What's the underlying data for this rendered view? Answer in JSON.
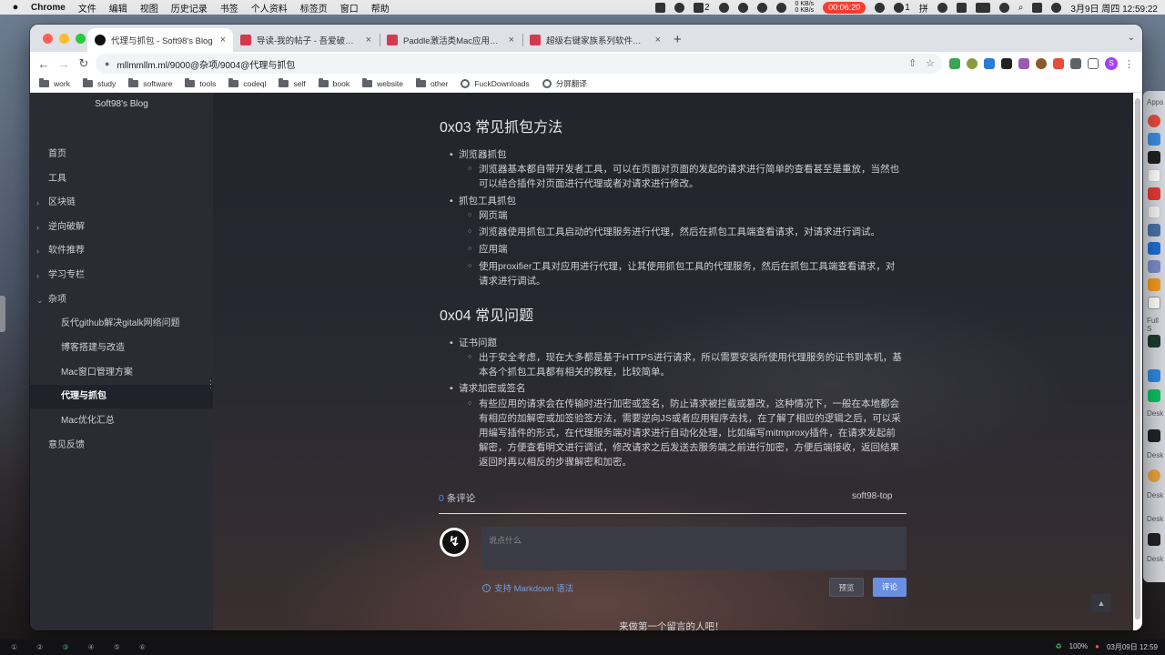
{
  "menubar": {
    "app_name": "Chrome",
    "items": [
      "文件",
      "编辑",
      "视图",
      "历史记录",
      "书签",
      "个人资料",
      "标签页",
      "窗口",
      "帮助"
    ],
    "net_up": "0 KB/s",
    "net_down": "0 KB/s",
    "badge_count": "2",
    "recording_time": "00:06:20",
    "ime_label": "拼",
    "count_one": "1",
    "date_time": "3月9日 周四  12:59:22"
  },
  "browser": {
    "tabs": [
      {
        "label": "代理与抓包 - Soft98's Blog",
        "active": true
      },
      {
        "label": "导读-我的帖子 - 吾爱破解 - LCG",
        "active": false
      },
      {
        "label": "Paddle激活类Mac应用通杀（Air",
        "active": false
      },
      {
        "label": "超级右键家族系列软件激活（iRi",
        "active": false
      }
    ],
    "new_tab": "+",
    "url": "mllmmllm.ml/9000@杂项/9004@代理与抓包",
    "profile_initial": "S",
    "bookmarks": [
      "work",
      "study",
      "software",
      "tools",
      "codeql",
      "self",
      "book",
      "website",
      "other"
    ],
    "bookmark_links": [
      "FuckDownloads",
      "分屏翻译"
    ]
  },
  "sidebar": {
    "title": "Soft98's Blog",
    "items": [
      {
        "label": "首页"
      },
      {
        "label": "工具"
      },
      {
        "label": "区块链",
        "caret": "›"
      },
      {
        "label": "逆向破解",
        "caret": "›"
      },
      {
        "label": "软件推荐",
        "caret": "›"
      },
      {
        "label": "学习专栏",
        "caret": "›"
      },
      {
        "label": "杂项",
        "caret": "⌄"
      },
      {
        "label": "反代github解决gitalk网络问题"
      },
      {
        "label": "博客搭建与改造"
      },
      {
        "label": "Mac窗口管理方案"
      },
      {
        "label": "代理与抓包",
        "active": true
      },
      {
        "label": "Mac优化汇总"
      },
      {
        "label": "意见反馈"
      }
    ]
  },
  "article": {
    "section3": {
      "heading": "0x03 常见抓包方法",
      "item1": "浏览器抓包",
      "item1_sub": "浏览器基本都自带开发者工具，可以在页面对页面的发起的请求进行简单的查看甚至是重放，当然也可以结合插件对页面进行代理或者对请求进行修改。",
      "item2": "抓包工具抓包",
      "item2_sub1": "网页端",
      "item2_sub2": "浏览器使用抓包工具启动的代理服务进行代理，然后在抓包工具端查看请求，对请求进行调试。",
      "item2_sub3": "应用端",
      "item2_sub4": "使用proxifier工具对应用进行代理，让其使用抓包工具的代理服务，然后在抓包工具端查看请求，对请求进行调试。"
    },
    "section4": {
      "heading": "0x04 常见问题",
      "item1": "证书问题",
      "item1_sub": "出于安全考虑，现在大多都是基于HTTPS进行请求，所以需要安装所使用代理服务的证书到本机，基本各个抓包工具都有相关的教程，比较简单。",
      "item2": "请求加密或签名",
      "item2_sub": "有些应用的请求会在传输时进行加密或签名，防止请求被拦截或篡改，这种情况下，一般在本地都会有相应的加解密或加签验签方法，需要逆向JS或者应用程序去找，在了解了相应的逻辑之后，可以采用编写插件的形式，在代理服务端对请求进行自动化处理，比如编写mitmproxy插件，在请求发起前解密，方便查看明文进行调试，修改请求之后发送去服务端之前进行加密，方便后端接收，返回结果返回时再以相反的步骤解密和加密。"
    }
  },
  "comments": {
    "count": "0",
    "count_suffix": " 条评论",
    "user": "soft98-top",
    "placeholder": "说点什么",
    "markdown_hint": "支持 Markdown 语法",
    "preview_label": "预览",
    "submit_label": "评论",
    "empty_text": "来做第一个留言的人吧！"
  },
  "dock_labels": [
    "Apps",
    "Full S",
    "Desk",
    "Desk",
    "Desk",
    "Desk",
    "Desk"
  ],
  "taskbar": {
    "workspaces": [
      "①",
      "②",
      "③",
      "④",
      "⑤",
      "⑥"
    ],
    "battery": "100%",
    "datetime": "03月09日 12:59"
  },
  "colors": {
    "accent_blue": "#6b8fe0",
    "link_blue": "#5b8fd8",
    "sidebar_bg": "#2a2b33",
    "record_red": "#ff3b30"
  }
}
